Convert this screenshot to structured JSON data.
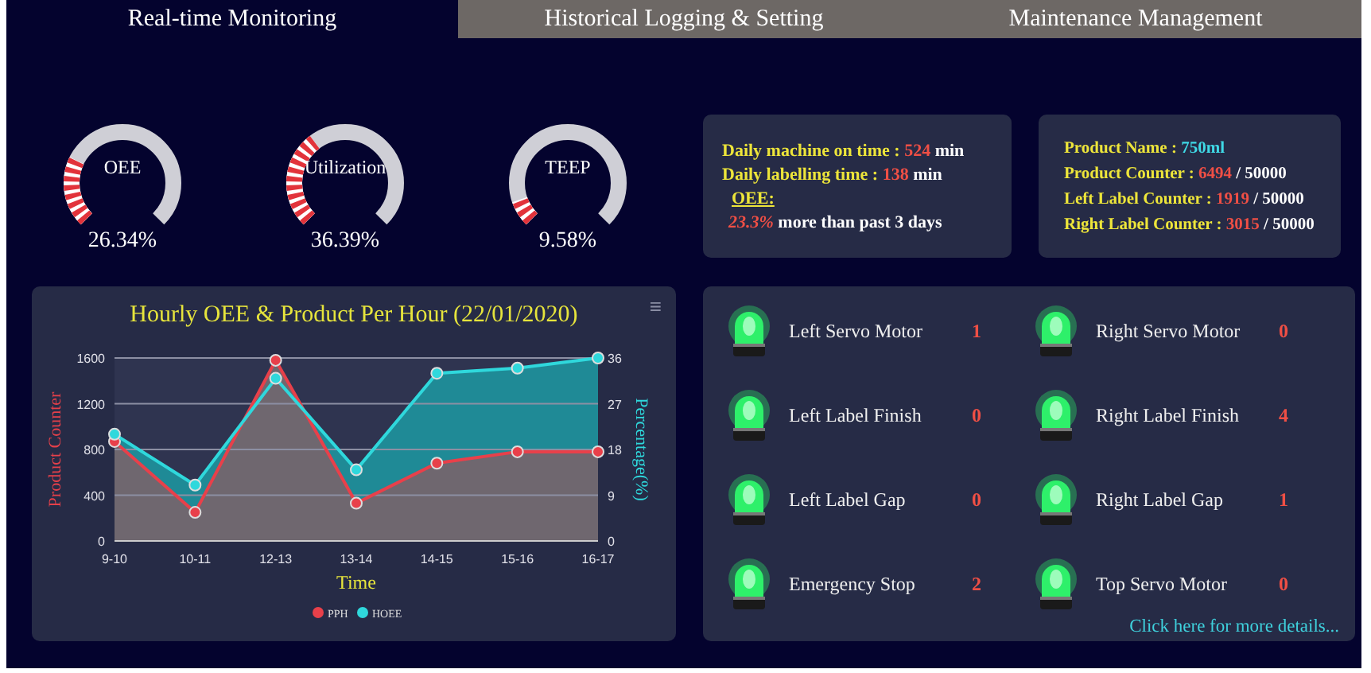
{
  "tabs": [
    {
      "label": "Real-time Monitoring",
      "selected": true
    },
    {
      "label": "Historical Logging & Setting",
      "selected": false
    },
    {
      "label": "Maintenance Management",
      "selected": false
    }
  ],
  "gauges": [
    {
      "label": "OEE",
      "reading": "26.34%"
    },
    {
      "label": "Utilization",
      "reading": "36.39%"
    },
    {
      "label": "TEEP",
      "reading": "9.58%"
    }
  ],
  "time_card": {
    "lines": [
      {
        "kind": "stat",
        "label": "Daily machine on time : ",
        "value": "524",
        "unit": "min"
      },
      {
        "kind": "stat",
        "label": "Daily labelling time : ",
        "value": "138",
        "unit": "min"
      },
      {
        "kind": "heading",
        "label": "OEE:"
      },
      {
        "kind": "trend",
        "value": "23.3%",
        "text": "more than past 3 days"
      }
    ]
  },
  "product_card": {
    "lines": [
      {
        "kind": "name",
        "label": "Product Name : ",
        "value": "750ml"
      },
      {
        "kind": "counter",
        "label": "Product Counter : ",
        "value": "6494",
        "total": "/ 50000"
      },
      {
        "kind": "counter",
        "label": "Left Label Counter : ",
        "value": "1919",
        "total": "/ 50000"
      },
      {
        "kind": "counter",
        "label": "Right Label Counter : ",
        "value": "3015",
        "total": "/ 50000"
      }
    ]
  },
  "chart": {
    "menu": "≡",
    "chart_data": {
      "type": "area",
      "grid": true,
      "legend": true,
      "title": "Hourly OEE & Product Per Hour (22/01/2020)",
      "xlabel": "Time",
      "ylabel": "Product Counter",
      "y2label": "Percentage(%)",
      "categories": [
        "9-10",
        "10-11",
        "12-13",
        "13-14",
        "14-15",
        "15-16",
        "16-17"
      ],
      "ylim": [
        0,
        1600
      ],
      "yticks": [
        0,
        400,
        800,
        1200,
        1600
      ],
      "y2lim": [
        0,
        36
      ],
      "y2ticks": [
        0,
        9,
        18,
        27,
        36
      ],
      "series": [
        {
          "name": "PPH",
          "color": "#e8404a",
          "marker": "circle",
          "values": [
            870,
            250,
            1580,
            330,
            680,
            780,
            780
          ]
        },
        {
          "name": "HOEE",
          "color": "#2fd8dc",
          "axis": "y2",
          "marker": "circle",
          "values": [
            21,
            11,
            32,
            14,
            33,
            34,
            36
          ]
        }
      ]
    }
  },
  "status": {
    "columns": [
      {
        "items": [
          {
            "label": "Left Servo Motor",
            "count": "1",
            "on": true
          },
          {
            "label": "Left Label Finish",
            "count": "0",
            "on": true
          },
          {
            "label": "Left Label Gap",
            "count": "0",
            "on": true
          },
          {
            "label": "Emergency Stop",
            "count": "2",
            "on": true
          }
        ]
      },
      {
        "items": [
          {
            "label": "Right Servo Motor",
            "count": "0",
            "on": true
          },
          {
            "label": "Right Label Finish",
            "count": "4",
            "on": true
          },
          {
            "label": "Right Label Gap",
            "count": "1",
            "on": true
          },
          {
            "label": "Top Servo Motor",
            "count": "0",
            "on": true
          }
        ]
      }
    ],
    "link": "Click here for more details..."
  }
}
